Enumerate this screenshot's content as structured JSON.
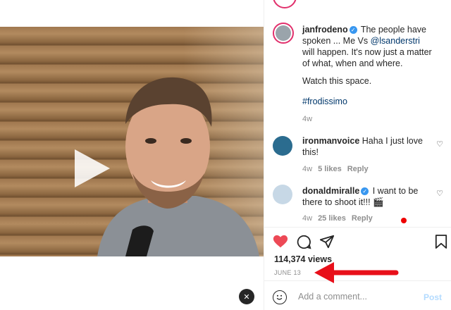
{
  "post": {
    "caption_user": "janfrodeno",
    "caption_text_1": " The people have spoken ... Me Vs ",
    "caption_mention": "@lsanderstri",
    "caption_text_2": " will happen. It's now just a matter of what, when and where.",
    "caption_line2": "Watch this space.",
    "caption_hashtag": "#frodissimo",
    "caption_age": "4w",
    "verified_mark": "✓"
  },
  "comments": [
    {
      "user": "ironmanvoice",
      "text": " Haha I just love this!",
      "age": "4w",
      "likes": "5 likes",
      "reply": "Reply"
    },
    {
      "user": "donaldmiralle",
      "text": " I want to be there to shoot it!!! 🎬",
      "age": "4w",
      "likes": "25 likes",
      "reply": "Reply"
    }
  ],
  "stats": {
    "views": "114,374 views",
    "date": "JUNE 13"
  },
  "comment_box": {
    "placeholder": "Add a comment...",
    "post_label": "Post"
  },
  "colors": {
    "like": "#ed4956",
    "verified": "#3897f0",
    "arrow": "#e8101a"
  },
  "icons": [
    "play-icon",
    "mute-icon",
    "heart-icon",
    "comment-icon",
    "share-icon",
    "bookmark-icon",
    "smile-icon"
  ]
}
